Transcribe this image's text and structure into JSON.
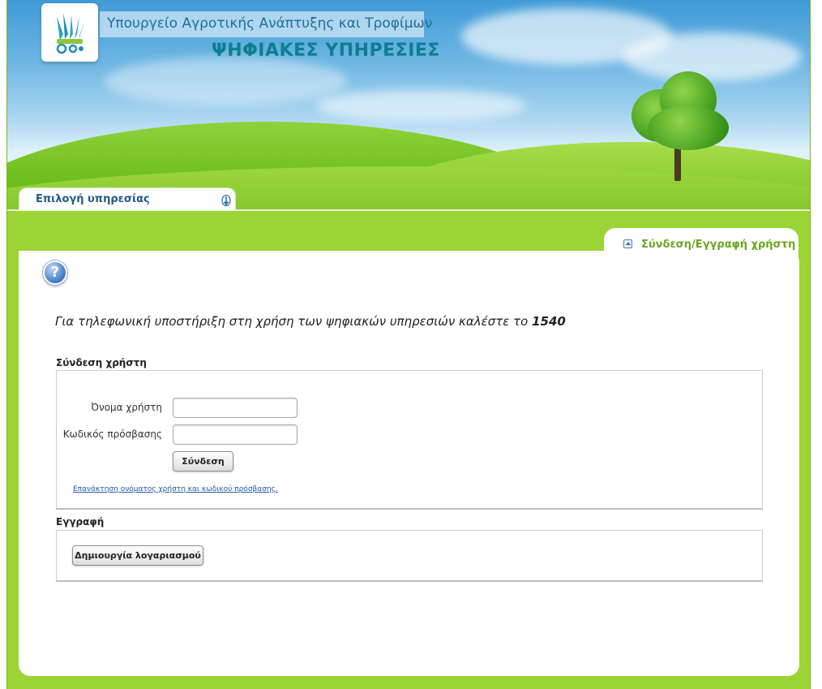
{
  "header": {
    "ministry_title": "Υπουργείο Αγροτικής Ανάπτυξης και Τροφίμων",
    "services_title": "ΨΗΦΙΑΚΕΣ ΥΠΗΡΕΣΙΕΣ",
    "logo_icon": "ministry-logo-icon"
  },
  "service_tab": {
    "label": "Επιλογή υπηρεσίας",
    "icon": "scroll-arrows-icon"
  },
  "user_tab": {
    "label": "Σύνδεση/Εγγραφή χρήστη",
    "icon": "collapse-up-icon"
  },
  "help": {
    "icon": "question-mark-icon",
    "glyph": "?"
  },
  "support": {
    "text": "Για τηλεφωνική υποστήριξη στη χρήση των ψηφιακών υπηρεσιών καλέστε το ",
    "number": "1540"
  },
  "login": {
    "section_title": "Σύνδεση χρήστη",
    "username_label": "Όνομα χρήστη",
    "username_value": "",
    "password_label": "Κωδικός πρόσβασης",
    "password_value": "",
    "submit_label": "Σύνδεση",
    "recover_link": "Επανάκτηση ονόματος χρήστη και κωδικού πρόσβασης."
  },
  "register": {
    "section_title": "Εγγραφή",
    "create_label": "Δημιουργία λογαριασμού"
  },
  "colors": {
    "page_green": "#9bd435",
    "title_blue": "#1d6f95",
    "services_teal": "#0d7e8e",
    "tab_green": "#6aa51e",
    "link_blue": "#2259a8"
  }
}
